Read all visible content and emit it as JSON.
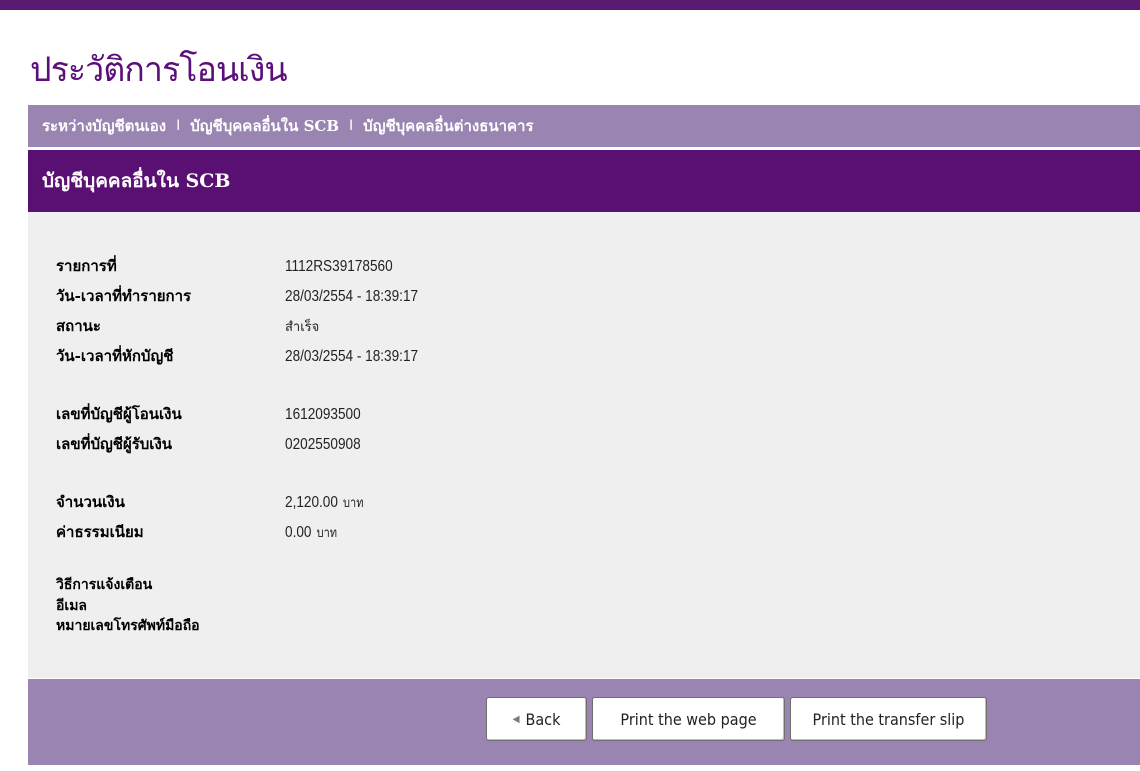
{
  "page": {
    "title": "ประวัติการโอนเงิน"
  },
  "subnav": {
    "items": [
      {
        "label": "ระหว่างบัญชีตนเอง"
      },
      {
        "label": "บัญชีบุคคลอื่นใน SCB"
      },
      {
        "label": "บัญชีบุคคลอื่นต่างธนาคาร"
      }
    ],
    "separator": "I"
  },
  "section": {
    "title": "บัญชีบุคคลอื่นใน SCB"
  },
  "details": {
    "transaction_no_label": "รายการที่",
    "transaction_no": "1112RS39178560",
    "txn_datetime_label": "วัน-เวลาที่ทำรายการ",
    "txn_datetime": "28/03/2554 - 18:39:17",
    "status_label": "สถานะ",
    "status": "สำเร็จ",
    "debit_datetime_label": "วัน-เวลาที่หักบัญชี",
    "debit_datetime": "28/03/2554 - 18:39:17",
    "sender_account_label": "เลขที่บัญชีผู้โอนเงิน",
    "sender_account": "1612093500",
    "receiver_account_label": "เลขที่บัญชีผู้รับเงิน",
    "receiver_account": "0202550908",
    "amount_label": "จำนวนเงิน",
    "amount": "2,120.00",
    "fee_label": "ค่าธรรมเนียม",
    "fee": "0.00",
    "currency_unit": "บาท",
    "notify_method_label": "วิธีการแจ้งเตือน",
    "email_label": "อีเมล",
    "mobile_label": "หมายเลขโทรศัพท์มือถือ"
  },
  "buttons": {
    "back": "Back",
    "print_web": "Print the web page",
    "print_slip": "Print the transfer slip"
  },
  "colors": {
    "brand_purple": "#5a0f72",
    "light_purple": "#9a85b2",
    "content_bg": "#efefef"
  }
}
